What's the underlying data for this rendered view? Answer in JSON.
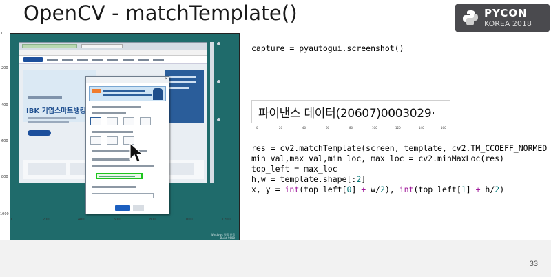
{
  "slide": {
    "title": "OpenCV - matchTemplate()",
    "page_number": "33"
  },
  "logo": {
    "line1": "PYCON",
    "line2": "KOREA 2018"
  },
  "plot": {
    "y_ticks": [
      "0",
      "200",
      "400",
      "600",
      "800",
      "1000"
    ],
    "x_ticks": [
      "0",
      "200",
      "400",
      "600",
      "800",
      "1000",
      "1200"
    ],
    "screenshot": {
      "hero_text": "IBK 기업스마트뱅킹",
      "taskbar_text": "Windows 정품 인증\nBuild 9600"
    }
  },
  "code": {
    "capture_line": "capture = pyautogui.screenshot()",
    "template_image_text": "파이낸스 데이터(20607)0003029·",
    "template_ticks": [
      "0",
      "20",
      "40",
      "60",
      "80",
      "100",
      "120",
      "140",
      "160"
    ],
    "lines": [
      "res = cv2.matchTemplate(screen, template, cv2.TM_CCOEFF_NORMED",
      "min_val,max_val,min_loc, max_loc = cv2.minMaxLoc(res)",
      "top_left = max_loc",
      "h,w = template.shape[:2]"
    ],
    "last_line": {
      "p1": "x, y = ",
      "int1": "int",
      "p2": "(top_left[",
      "n0": "0",
      "p3": "] ",
      "plus1": "+",
      "p4": " w/",
      "two1": "2",
      "p5": "), ",
      "int2": "int",
      "p6": "(top_left[",
      "n1": "1",
      "p7": "] ",
      "plus2": "+",
      "p8": " h/",
      "two2": "2",
      "p9": ")"
    },
    "shape_slice_num": "2"
  },
  "colors": {
    "screen_bg": "#1f6b6b",
    "match_box": "#1ec51e",
    "keyword": "#a0199a",
    "number": "#007777"
  }
}
